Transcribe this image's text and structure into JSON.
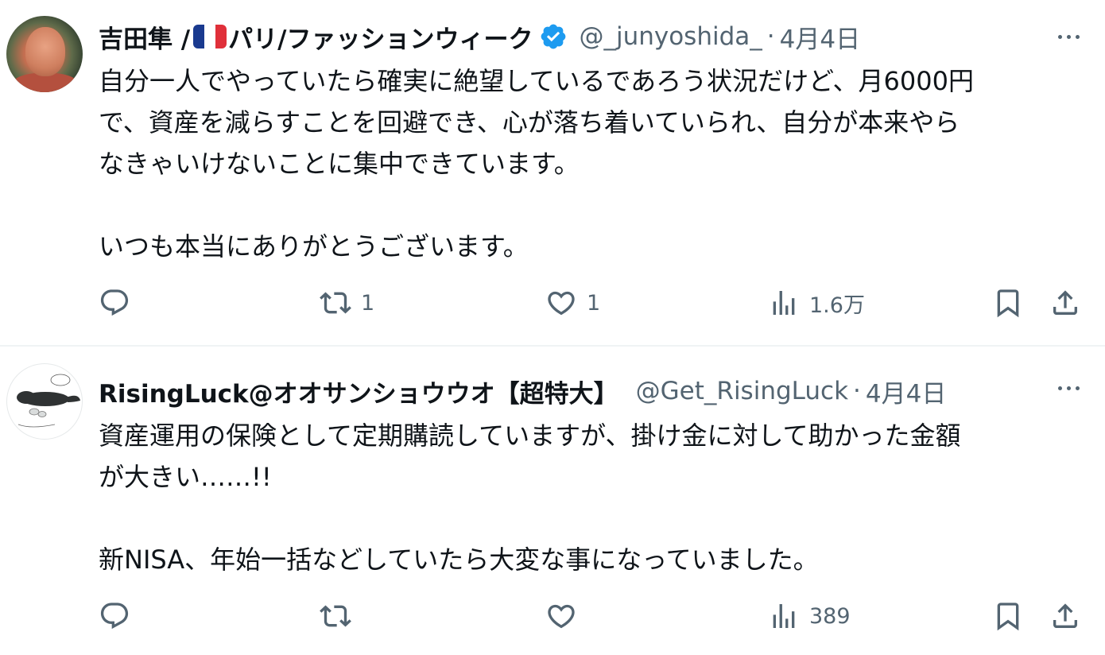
{
  "tweets": [
    {
      "display_name": "吉田隼 /",
      "display_name_suffix": "パリ/ファッションウィーク",
      "flag_colors": [
        "#1a3a8f",
        "#ffffff",
        "#e0303a"
      ],
      "verified_color": "#1d9bf0",
      "handle": "@_junyoshida_",
      "separator": "·",
      "date": "4月4日",
      "text": "自分一人でやっていたら確実に絶望しているであろう状況だけど、月6000円\nで、資産を減らすことを回避でき、心が落ち着いていられ、自分が本来やら\nなきゃいけないことに集中できています。\n\nいつも本当にありがとうございます。",
      "actions": {
        "reply_count": "",
        "retweet_count": "1",
        "like_count": "1",
        "views_count": "1.6万"
      }
    },
    {
      "display_name": "RisingLuck@オオサンショウウオ【超特大】",
      "handle": "@Get_RisingLuck",
      "separator": "·",
      "date": "4月4日",
      "text": "資産運用の保険として定期購読していますが、掛け金に対して助かった金額\nが大きい……!!\n\n新NISA、年始一括などしていたら大変な事になっていました。",
      "actions": {
        "reply_count": "",
        "retweet_count": "",
        "like_count": "",
        "views_count": "389"
      }
    }
  ],
  "icons": {
    "more": "more-horizontal-icon",
    "reply": "reply-icon",
    "retweet": "retweet-icon",
    "like": "heart-icon",
    "views": "views-chart-icon",
    "bookmark": "bookmark-icon",
    "share": "share-icon"
  },
  "colors": {
    "text_primary": "#0f1419",
    "text_secondary": "#536471",
    "divider": "#eff3f4"
  }
}
